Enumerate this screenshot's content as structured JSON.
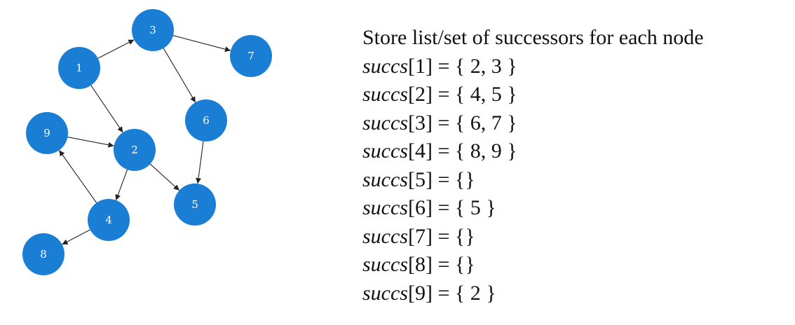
{
  "diagram": {
    "nodes": [
      {
        "id": "1",
        "label": "1"
      },
      {
        "id": "2",
        "label": "2"
      },
      {
        "id": "3",
        "label": "3"
      },
      {
        "id": "4",
        "label": "4"
      },
      {
        "id": "5",
        "label": "5"
      },
      {
        "id": "6",
        "label": "6"
      },
      {
        "id": "7",
        "label": "7"
      },
      {
        "id": "8",
        "label": "8"
      },
      {
        "id": "9",
        "label": "9"
      }
    ],
    "edges": [
      {
        "from": "1",
        "to": "3"
      },
      {
        "from": "1",
        "to": "2"
      },
      {
        "from": "3",
        "to": "7"
      },
      {
        "from": "3",
        "to": "6"
      },
      {
        "from": "6",
        "to": "5"
      },
      {
        "from": "9",
        "to": "2"
      },
      {
        "from": "2",
        "to": "4"
      },
      {
        "from": "2",
        "to": "5"
      },
      {
        "from": "4",
        "to": "9"
      },
      {
        "from": "4",
        "to": "8"
      }
    ],
    "node_color": "#1a7fd4",
    "label_color": "#ffffff",
    "edge_color": "#222222"
  },
  "text": {
    "heading": "Store list/set of successors for each node",
    "succ_name": "succs",
    "lines": [
      {
        "index": "[1]",
        "value": " = { 2, 3 }"
      },
      {
        "index": "[2]",
        "value": " = { 4, 5 }"
      },
      {
        "index": "[3]",
        "value": " = { 6, 7 }"
      },
      {
        "index": "[4]",
        "value": " = { 8, 9 }"
      },
      {
        "index": "[5]",
        "value": " = {}"
      },
      {
        "index": "[6]",
        "value": " = { 5 }"
      },
      {
        "index": "[7]",
        "value": " = {}"
      },
      {
        "index": "[8]",
        "value": " = {}"
      },
      {
        "index": "[9]",
        "value": " = { 2 }"
      }
    ]
  }
}
